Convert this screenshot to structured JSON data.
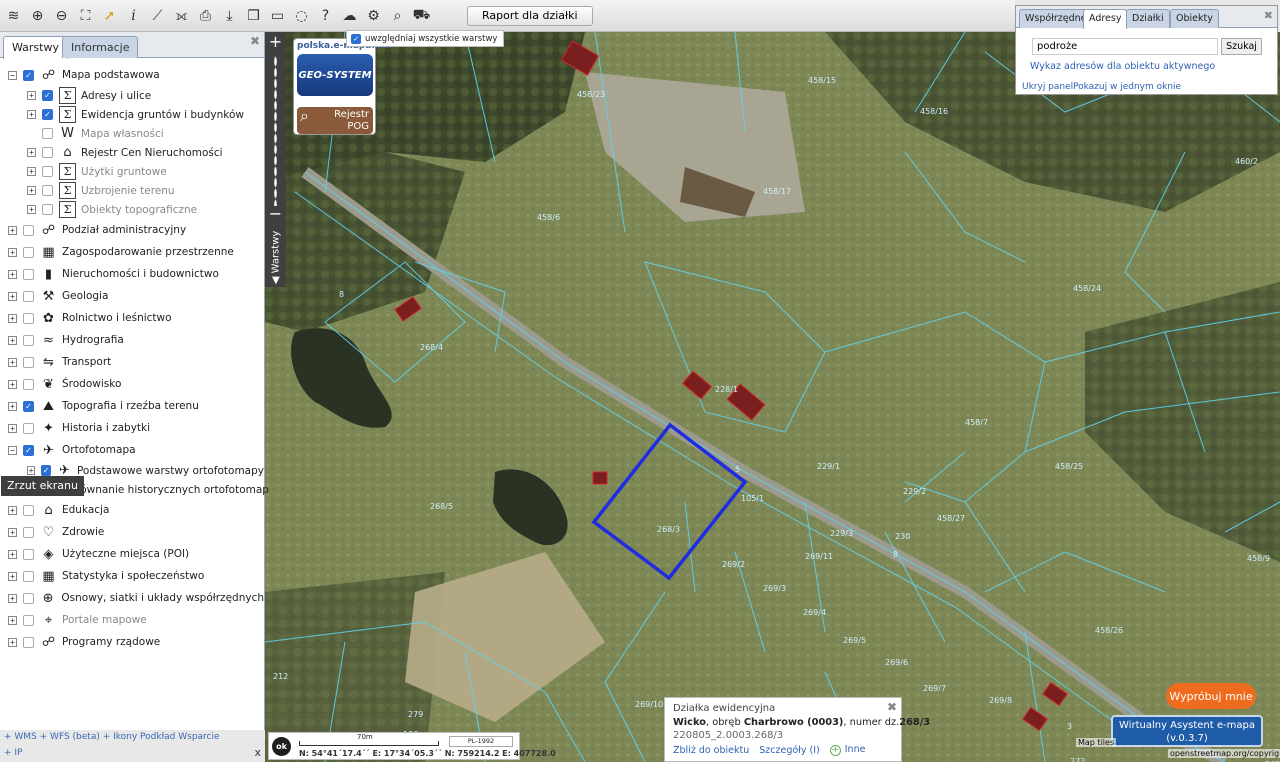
{
  "toolbar": {
    "icons": [
      "layers-icon",
      "zoom-in-icon",
      "zoom-out-icon",
      "zoom-extent-icon",
      "select-arrow-icon",
      "info-icon",
      "measure-icon",
      "measure-area-icon",
      "print-icon",
      "download-icon",
      "copy-map-icon",
      "screen-icon",
      "comment-icon",
      "help-icon",
      "cloud-icon",
      "settings-icon",
      "search-map-icon",
      "cart-icon",
      "color-grid-icon"
    ],
    "raport_label": "Raport dla działki"
  },
  "left_panel": {
    "tabs": [
      "Warstwy",
      "Informacje"
    ],
    "tooltip": "Zrzut ekranu",
    "layers": [
      {
        "label": "Mapa podstawowa",
        "checked": true,
        "sub": false,
        "expander": "−",
        "icon": "☍",
        "dim": false
      },
      {
        "label": "Adresy i ulice",
        "checked": true,
        "sub": true,
        "expander": "+",
        "icon": "Σ",
        "dim": false
      },
      {
        "label": "Ewidencja gruntów i budynków",
        "checked": true,
        "sub": true,
        "expander": "+",
        "icon": "Σ",
        "dim": false
      },
      {
        "label": "Mapa własności",
        "checked": false,
        "sub": true,
        "expander": "",
        "icon": "W",
        "dim": true
      },
      {
        "label": "Rejestr Cen Nieruchomości",
        "checked": false,
        "sub": true,
        "expander": "+",
        "icon": "⌂",
        "dim": false
      },
      {
        "label": "Użytki gruntowe",
        "checked": false,
        "sub": true,
        "expander": "+",
        "icon": "Σ",
        "dim": true
      },
      {
        "label": "Uzbrojenie terenu",
        "checked": false,
        "sub": true,
        "expander": "+",
        "icon": "Σ",
        "dim": true
      },
      {
        "label": "Obiekty topograficzne",
        "checked": false,
        "sub": true,
        "expander": "+",
        "icon": "Σ",
        "dim": true
      },
      {
        "label": "Podział administracyjny",
        "checked": false,
        "sub": false,
        "expander": "+",
        "icon": "☍",
        "dim": false
      },
      {
        "label": "Zagospodarowanie przestrzenne",
        "checked": false,
        "sub": false,
        "expander": "+",
        "icon": "▦",
        "dim": false
      },
      {
        "label": "Nieruchomości i budownictwo",
        "checked": false,
        "sub": false,
        "expander": "+",
        "icon": "▮",
        "dim": false
      },
      {
        "label": "Geologia",
        "checked": false,
        "sub": false,
        "expander": "+",
        "icon": "⚒",
        "dim": false
      },
      {
        "label": "Rolnictwo i leśnictwo",
        "checked": false,
        "sub": false,
        "expander": "+",
        "icon": "✿",
        "dim": false
      },
      {
        "label": "Hydrografia",
        "checked": false,
        "sub": false,
        "expander": "+",
        "icon": "≈",
        "dim": false
      },
      {
        "label": "Transport",
        "checked": false,
        "sub": false,
        "expander": "+",
        "icon": "⇋",
        "dim": false
      },
      {
        "label": "Środowisko",
        "checked": false,
        "sub": false,
        "expander": "+",
        "icon": "❦",
        "dim": false
      },
      {
        "label": "Topografia i rzeźba terenu",
        "checked": true,
        "sub": false,
        "expander": "+",
        "icon": "⛰",
        "dim": false
      },
      {
        "label": "Historia i zabytki",
        "checked": false,
        "sub": false,
        "expander": "+",
        "icon": "✦",
        "dim": false
      },
      {
        "label": "Ortofotomapa",
        "checked": true,
        "sub": false,
        "expander": "−",
        "icon": "✈",
        "dim": false
      },
      {
        "label": "Podstawowe warstwy ortofotomapy",
        "checked": true,
        "sub": true,
        "expander": "+",
        "icon": "✈",
        "dim": false
      },
      {
        "label": "Porównanie historycznych ortofotomap",
        "checked": false,
        "sub": true,
        "expander": "+",
        "icon": "✈",
        "dim": false
      },
      {
        "label": "Edukacja",
        "checked": false,
        "sub": false,
        "expander": "+",
        "icon": "⌂",
        "dim": false
      },
      {
        "label": "Zdrowie",
        "checked": false,
        "sub": false,
        "expander": "+",
        "icon": "♡",
        "dim": false
      },
      {
        "label": "Użyteczne miejsca (POI)",
        "checked": false,
        "sub": false,
        "expander": "+",
        "icon": "◈",
        "dim": false
      },
      {
        "label": "Statystyka i społeczeństwo",
        "checked": false,
        "sub": false,
        "expander": "+",
        "icon": "▦",
        "dim": false
      },
      {
        "label": "Osnowy, siatki i układy współrzędnych",
        "checked": false,
        "sub": false,
        "expander": "+",
        "icon": "⊕",
        "dim": false
      },
      {
        "label": "Portale mapowe",
        "checked": false,
        "sub": false,
        "expander": "+",
        "icon": "⌖",
        "dim": true
      },
      {
        "label": "Programy rządowe",
        "checked": false,
        "sub": false,
        "expander": "+",
        "icon": "☍",
        "dim": false
      }
    ],
    "bottom_line1": "+ WMS + WFS (beta) + Ikony Podkład Wsparcie",
    "bottom_line2": "+ IP",
    "bottom_close": "x"
  },
  "map_strip": {
    "plus": "+",
    "minus": "−",
    "vtab": "◀ Warstwy"
  },
  "logo": {
    "url": "polska.e-mapa.net",
    "geo": "GEO-SYSTEM",
    "pog": "Rejestr\nPOG"
  },
  "uwzgledniaj": "uwzględniaj wszystkie warstwy",
  "search_panel": {
    "tabs": [
      "Współrzędne",
      "Adresy",
      "Działki",
      "Obiekty"
    ],
    "active_tab": "Adresy",
    "input_value": "podroże",
    "button": "Szukaj",
    "link_addresses": "Wykaz adresów dla obiektu aktywnego",
    "link_hide": "Ukryj panel",
    "link_one_window": "Pokazuj w jednym oknie"
  },
  "info_box": {
    "title": "Działka ewidencyjna",
    "place": "Wicko",
    "mid": ", obręb ",
    "obreb": "Charbrowo (0003)",
    "mid2": ", numer dz.",
    "number": "268/3",
    "code": "220805_2.0003.268/3",
    "link_zoom": "Zbliż do obiektu",
    "link_details": "Szczegóły (I)",
    "link_more": "Inne"
  },
  "scalebar": {
    "ok": "ok",
    "scale": "70m",
    "crs": "PL-1992",
    "coords": "N: 54°41´17.4´´  E: 17°34´05.3´´   N: 759214.2   E: 407728.0"
  },
  "buttons": {
    "wyprobuj": "Wypróbuj mnie",
    "asystent": "Wirtualny Asystent e-mapa\n(v.0.3.7)"
  },
  "attribution": {
    "line1": "Map tiles",
    "line2": "openstreetmap.org/copyright"
  },
  "parcel_labels": [
    {
      "t": "458/23"
    },
    {
      "t": "458/15"
    },
    {
      "t": "458/16"
    },
    {
      "t": "458/17"
    },
    {
      "t": "458/6"
    },
    {
      "t": "460/2"
    },
    {
      "t": "458/24"
    },
    {
      "t": "268/4"
    },
    {
      "t": "228/1"
    },
    {
      "t": "229/1"
    },
    {
      "t": "458/7"
    },
    {
      "t": "458/25"
    },
    {
      "t": "229/2"
    },
    {
      "t": "268/5"
    },
    {
      "t": "105/1"
    },
    {
      "t": "268/3"
    },
    {
      "t": "229/3"
    },
    {
      "t": "230"
    },
    {
      "t": "458/27"
    },
    {
      "t": "269/2"
    },
    {
      "t": "269/11"
    },
    {
      "t": "269/3"
    },
    {
      "t": "269/4"
    },
    {
      "t": "269/5"
    },
    {
      "t": "269/6"
    },
    {
      "t": "269/7"
    },
    {
      "t": "269/8"
    },
    {
      "t": "269/10"
    },
    {
      "t": "458/9"
    },
    {
      "t": "458/26"
    },
    {
      "t": "212"
    },
    {
      "t": "210/1"
    },
    {
      "t": "279"
    },
    {
      "t": "186"
    },
    {
      "t": "272"
    },
    {
      "t": "269/12"
    },
    {
      "t": "8"
    },
    {
      "t": "5"
    },
    {
      "t": "8"
    },
    {
      "t": "3"
    }
  ]
}
